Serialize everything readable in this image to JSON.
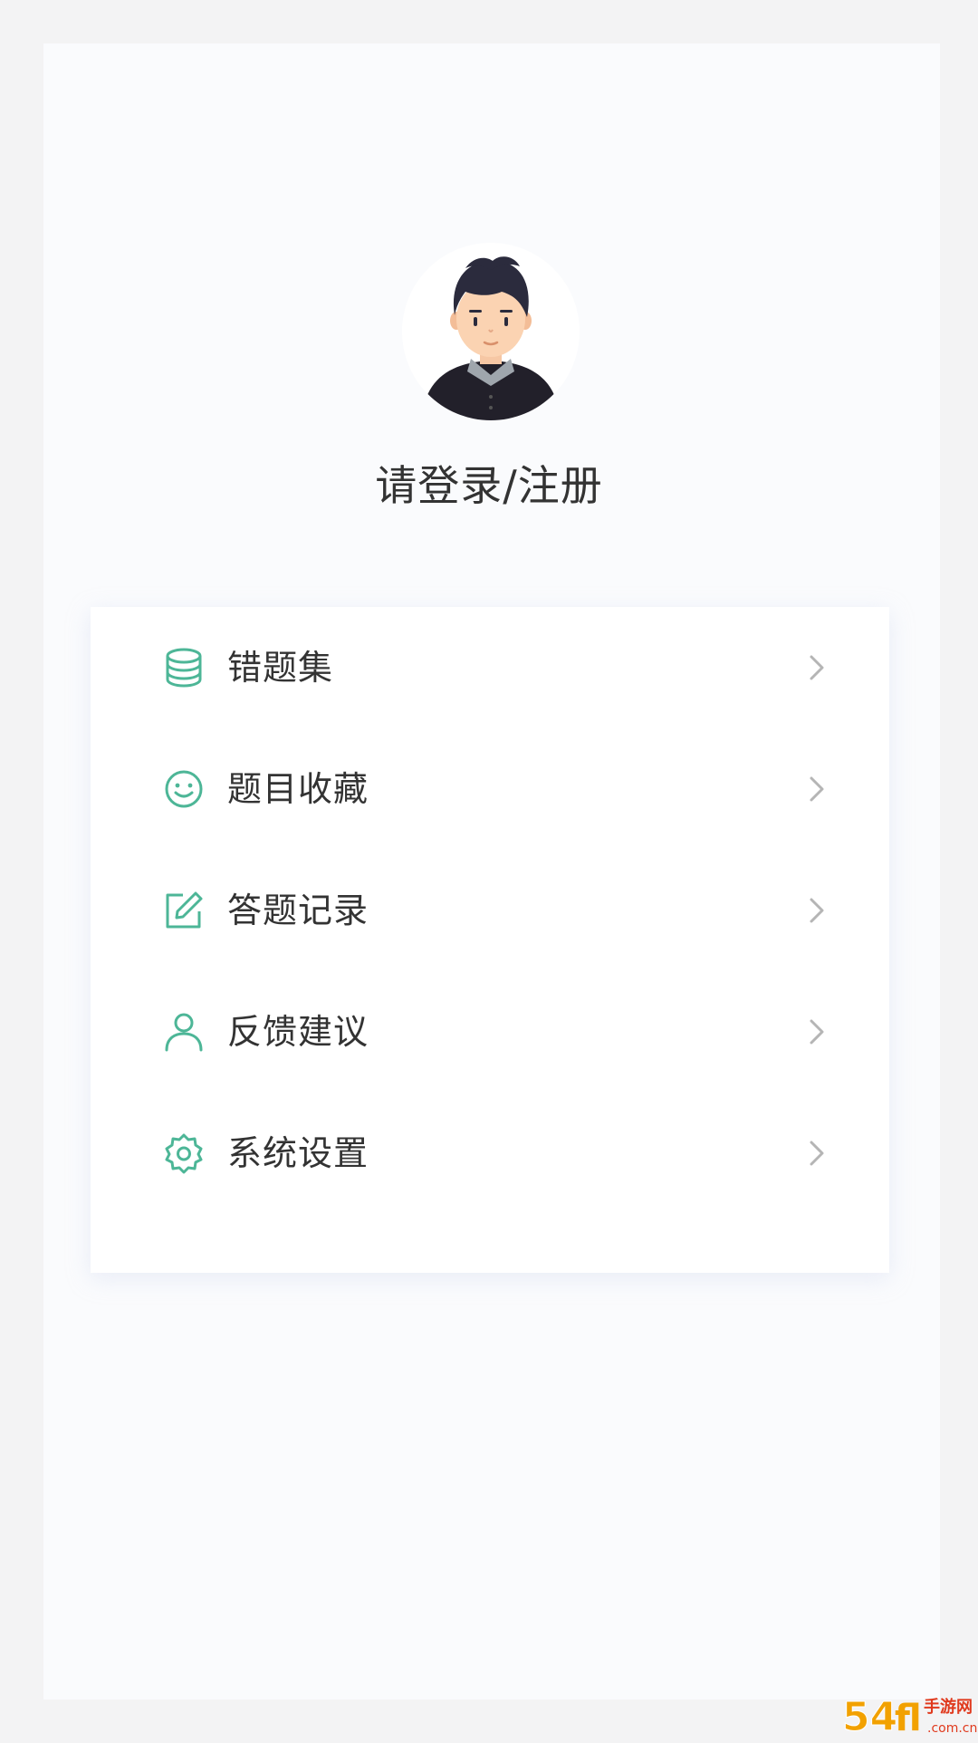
{
  "profile": {
    "login_prompt": "请登录/注册"
  },
  "menu": {
    "items": [
      {
        "label": "错题集",
        "icon": "database-icon"
      },
      {
        "label": "题目收藏",
        "icon": "smile-icon"
      },
      {
        "label": "答题记录",
        "icon": "edit-icon"
      },
      {
        "label": "反馈建议",
        "icon": "user-icon"
      },
      {
        "label": "系统设置",
        "icon": "gear-icon"
      }
    ]
  },
  "watermark": {
    "number": "54",
    "suffix": "手游网",
    "domain": ".com.cn"
  },
  "colors": {
    "accent": "#4db697",
    "chevron": "#b5b5b5",
    "text": "#333333",
    "background": "#fafbfd",
    "watermark": "#f2a100"
  }
}
